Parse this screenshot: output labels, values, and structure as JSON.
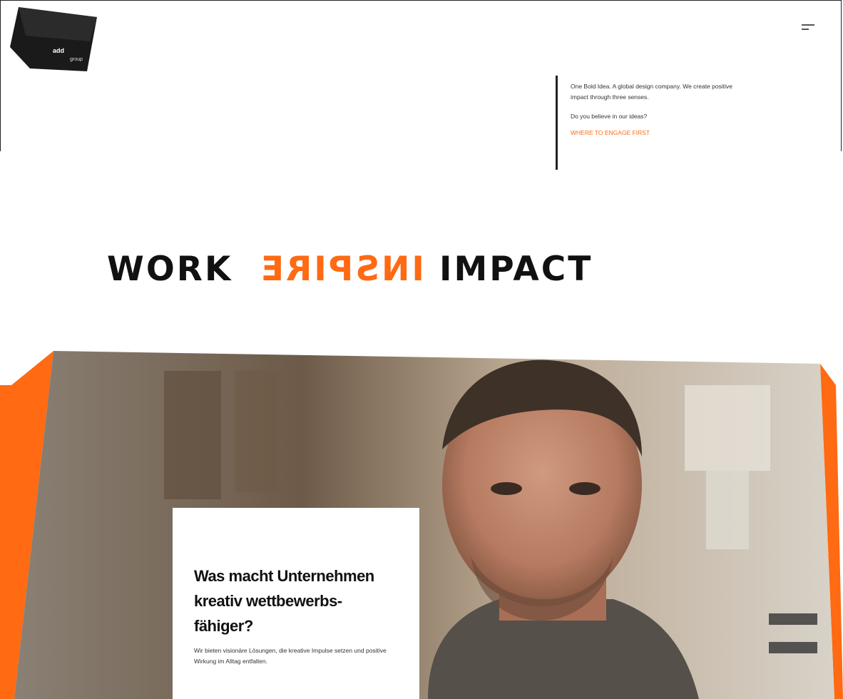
{
  "logo": {
    "brand_line_1": "add",
    "brand_line_2": "group"
  },
  "header": {
    "menu_icon": "hamburger-icon"
  },
  "intro": {
    "description": "One Bold Idea. A global design company. We create positive impact through three senses.",
    "question": "Do you believe in our ideas?",
    "link_label": "WHERE TO ENGAGE FIRST"
  },
  "tagline": {
    "word_1": "WORK",
    "word_2": "INSPIRE",
    "word_3": "IMPACT"
  },
  "hero": {
    "heading": "Was macht Unternehmen kreativ wettbewerbs-fähiger?",
    "text": "Wir bieten visionäre Lösungen, die kreative Impulse setzen und positive Wirkung im Alltag entfalten."
  },
  "colors": {
    "accent": "#ff6a13",
    "text": "#111111"
  }
}
